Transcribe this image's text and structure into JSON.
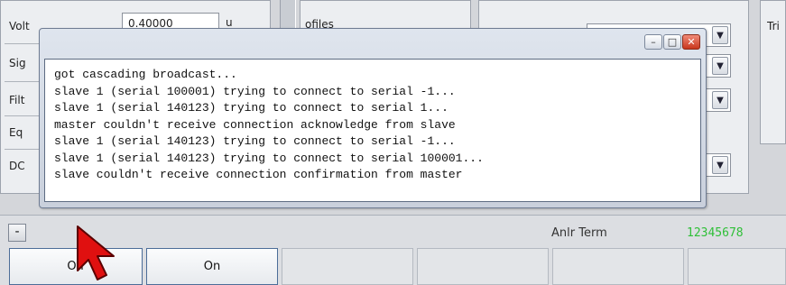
{
  "background": {
    "labels": [
      "Volt",
      "Sig",
      "Filt",
      "Eq",
      "DC"
    ],
    "voltage_value": "0.40000",
    "voltage_unit": "u",
    "profiles_label": "ofiles",
    "tri_label": "Tri"
  },
  "popup": {
    "log_lines": [
      "got cascading broadcast...",
      "slave 1 (serial 100001) trying to connect to serial -1...",
      "slave 1 (serial 140123) trying to connect to serial 1...",
      "master couldn't receive connection acknowledge from slave",
      "slave 1 (serial 140123) trying to connect to serial -1...",
      "slave 1 (serial 140123) trying to connect to serial 100001...",
      "slave couldn't receive connection confirmation from master"
    ],
    "minimize_glyph": "–",
    "maximize_glyph": "□",
    "close_glyph": "✕"
  },
  "bottom": {
    "minus_label": "-",
    "anlr_label": "Anlr Term",
    "anlr_value": "12345678",
    "off_label": "Off",
    "on_label": "On"
  },
  "colors": {
    "anlr_value": "#2fbf38",
    "cursor": "#e01010"
  },
  "icons": [
    "minimize-icon",
    "maximize-icon",
    "close-icon",
    "chevron-down-icon",
    "arrow-cursor-icon"
  ]
}
